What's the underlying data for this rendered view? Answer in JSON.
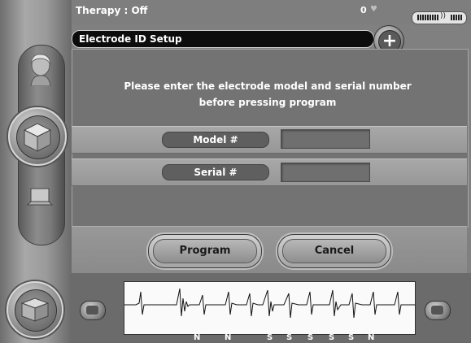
{
  "status": {
    "therapy": "Therapy : Off",
    "counter": "0"
  },
  "header": {
    "title": "Electrode ID Setup"
  },
  "form": {
    "instruction_line1": "Please enter the electrode model and serial number",
    "instruction_line2": "before pressing program",
    "model_label": "Model #",
    "model_value": "",
    "serial_label": "Serial #",
    "serial_value": ""
  },
  "actions": {
    "program": "Program",
    "cancel": "Cancel"
  },
  "egm": {
    "markers": [
      "N",
      "N",
      "S",
      "S",
      "S",
      "S",
      "S",
      "N"
    ]
  },
  "icons": {
    "nav": [
      "patient-face-icon",
      "device-box-icon",
      "laptop-icon",
      "home-device-icon"
    ],
    "status": [
      "heart-icon",
      "battery-icon",
      "wireless-icon",
      "signal-icon"
    ],
    "strip": [
      "camera-icon",
      "freeze-icon"
    ],
    "header": [
      "plus-icon"
    ]
  }
}
